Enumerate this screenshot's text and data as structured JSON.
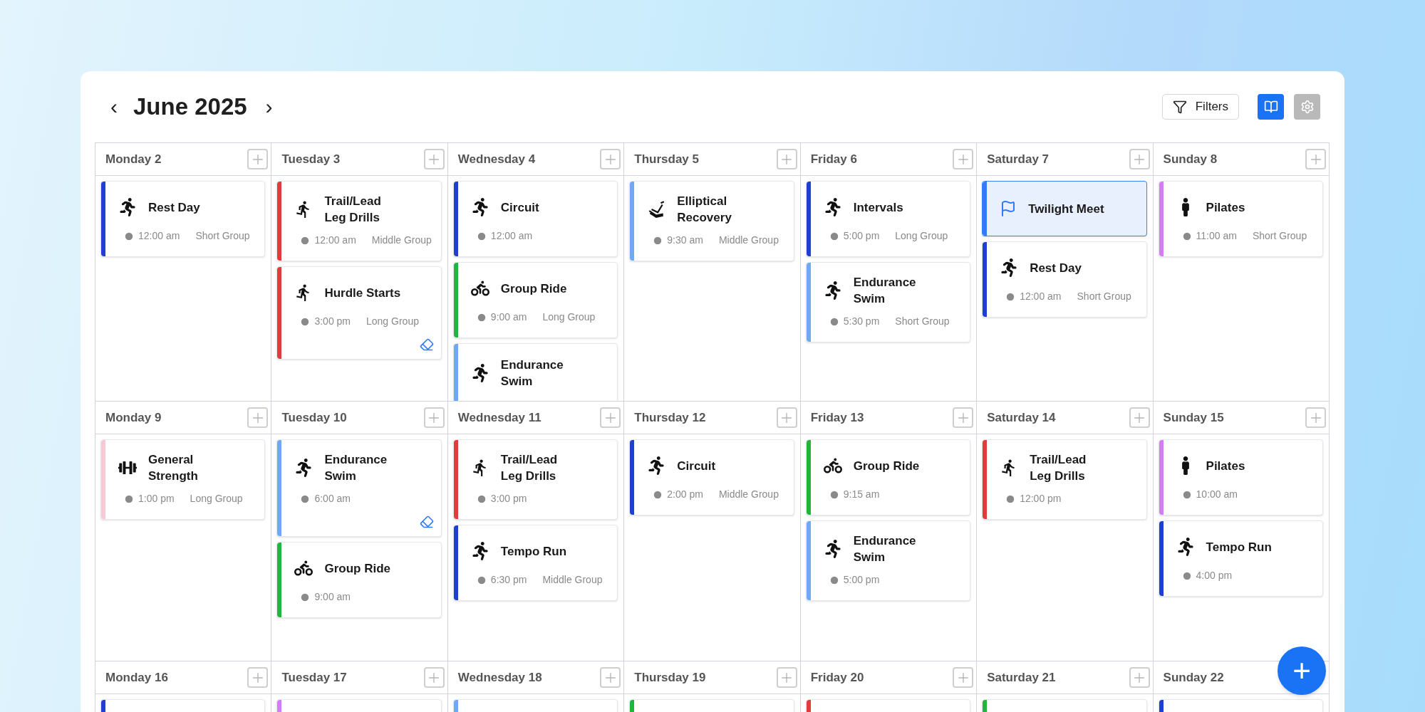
{
  "header": {
    "title": "June 2025",
    "prev": "‹",
    "next": "›"
  },
  "toolbar": [
    {
      "kind": "filter",
      "label": "Filters",
      "selected": false
    },
    {
      "kind": "book",
      "selected": true
    },
    {
      "kind": "settings",
      "selected": false
    }
  ],
  "weeks": [
    {
      "days": [
        {
          "label": "Monday 2",
          "events": [
            {
              "kind": "run",
              "title": "Rest Day",
              "time": "12:00 am",
              "group": "Short Group",
              "color": "#1e3fd1",
              "selected": false,
              "tagged": false
            }
          ]
        },
        {
          "label": "Tuesday 3",
          "events": [
            {
              "kind": "hurdle",
              "title": "Trail/Lead\nLeg Drills",
              "time": "12:00 am",
              "group": "Middle Group",
              "color": "#e03c3c",
              "selected": false,
              "tagged": false
            },
            {
              "kind": "hurdle",
              "title": "Hurdle Starts",
              "time": "3:00 pm",
              "group": "Long Group",
              "color": "#e03c3c",
              "selected": false,
              "tagged": true
            }
          ]
        },
        {
          "label": "Wednesday 4",
          "events": [
            {
              "kind": "run",
              "title": "Circuit",
              "time": "12:00 am",
              "color": "#1e3fd1",
              "selected": false,
              "tagged": false
            },
            {
              "kind": "bike",
              "title": "Group Ride",
              "time": "9:00 am",
              "group": "Long Group",
              "color": "#22b53b",
              "selected": false,
              "tagged": false
            },
            {
              "kind": "run",
              "title": "Endurance\nSwim",
              "color": "#6fa8f5",
              "selected": false,
              "tagged": false
            }
          ]
        },
        {
          "label": "Thursday 5",
          "events": [
            {
              "kind": "elliptical",
              "title": "Elliptical\nRecovery",
              "time": "9:30 am",
              "group": "Middle Group",
              "color": "#6fa8f5",
              "selected": false,
              "tagged": false
            }
          ]
        },
        {
          "label": "Friday 6",
          "events": [
            {
              "kind": "run",
              "title": "Intervals",
              "time": "5:00 pm",
              "group": "Long Group",
              "color": "#1e3fd1",
              "selected": false,
              "tagged": false
            },
            {
              "kind": "run",
              "title": "Endurance\nSwim",
              "time": "5:30 pm",
              "group": "Short Group",
              "color": "#6fa8f5",
              "selected": false,
              "tagged": false
            }
          ]
        },
        {
          "label": "Saturday 7",
          "events": [
            {
              "kind": "flag",
              "title": "Twilight Meet",
              "color": "#2f7cf6",
              "selected": true,
              "tagged": false
            },
            {
              "kind": "run",
              "title": "Rest Day",
              "time": "12:00 am",
              "group": "Short Group",
              "color": "#1e3fd1",
              "selected": false,
              "tagged": false
            }
          ]
        },
        {
          "label": "Sunday 8",
          "events": [
            {
              "kind": "person",
              "title": "Pilates",
              "time": "11:00 am",
              "group": "Short Group",
              "color": "#d57cf5",
              "selected": false,
              "tagged": false
            }
          ]
        }
      ]
    },
    {
      "days": [
        {
          "label": "Monday 9",
          "events": [
            {
              "kind": "weights",
              "title": "General\nStrength",
              "time": "1:00 pm",
              "group": "Long Group",
              "color": "#f9c8d4",
              "selected": false,
              "tagged": false
            }
          ]
        },
        {
          "label": "Tuesday 10",
          "events": [
            {
              "kind": "run",
              "title": "Endurance\nSwim",
              "time": "6:00 am",
              "color": "#6fa8f5",
              "selected": false,
              "tagged": true
            },
            {
              "kind": "bike",
              "title": "Group Ride",
              "time": "9:00 am",
              "color": "#22b53b",
              "selected": false,
              "tagged": false
            }
          ]
        },
        {
          "label": "Wednesday 11",
          "events": [
            {
              "kind": "hurdle",
              "title": "Trail/Lead\nLeg Drills",
              "time": "3:00 pm",
              "color": "#e03c3c",
              "selected": false,
              "tagged": false
            },
            {
              "kind": "run",
              "title": "Tempo Run",
              "time": "6:30 pm",
              "group": "Middle Group",
              "color": "#1e3fd1",
              "selected": false,
              "tagged": false
            }
          ]
        },
        {
          "label": "Thursday 12",
          "events": [
            {
              "kind": "run",
              "title": "Circuit",
              "time": "2:00 pm",
              "group": "Middle Group",
              "color": "#1e3fd1",
              "selected": false,
              "tagged": false
            }
          ]
        },
        {
          "label": "Friday 13",
          "events": [
            {
              "kind": "bike",
              "title": "Group Ride",
              "time": "9:15 am",
              "color": "#22b53b",
              "selected": false,
              "tagged": false
            },
            {
              "kind": "run",
              "title": "Endurance\nSwim",
              "time": "5:00 pm",
              "color": "#6fa8f5",
              "selected": false,
              "tagged": false
            }
          ]
        },
        {
          "label": "Saturday 14",
          "events": [
            {
              "kind": "hurdle",
              "title": "Trail/Lead\nLeg Drills",
              "time": "12:00 pm",
              "color": "#e03c3c",
              "selected": false,
              "tagged": false
            }
          ]
        },
        {
          "label": "Sunday 15",
          "events": [
            {
              "kind": "person",
              "title": "Pilates",
              "time": "10:00 am",
              "color": "#d57cf5",
              "selected": false,
              "tagged": false
            },
            {
              "kind": "run",
              "title": "Tempo Run",
              "time": "4:00 pm",
              "color": "#1e3fd1",
              "selected": false,
              "tagged": false
            }
          ]
        }
      ]
    },
    {
      "days": [
        {
          "label": "Monday 16",
          "stubs": [
            {
              "color": "#1e3fd1"
            }
          ]
        },
        {
          "label": "Tuesday 17",
          "stubs": [
            {
              "color": "#d57cf5"
            }
          ]
        },
        {
          "label": "Wednesday 18",
          "stubs": [
            {
              "color": "#6fa8f5"
            }
          ]
        },
        {
          "label": "Thursday 19",
          "stubs": [
            {
              "color": "#22b53b"
            }
          ]
        },
        {
          "label": "Friday 20",
          "stubs": [
            {
              "color": "#e03c3c"
            }
          ]
        },
        {
          "label": "Saturday 21",
          "stubs": [
            {
              "color": "#22b53b"
            }
          ]
        },
        {
          "label": "Sunday 22",
          "stubs": [
            {
              "color": "#1e3fd1"
            }
          ]
        }
      ]
    }
  ],
  "fab": {
    "label": "+"
  }
}
